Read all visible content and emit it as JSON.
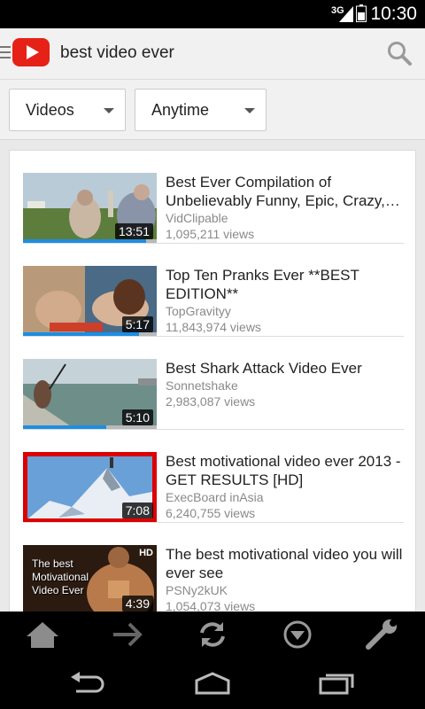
{
  "status": {
    "network": "3G",
    "time": "10:30"
  },
  "search": {
    "query": "best video ever"
  },
  "filters": {
    "type": "Videos",
    "time": "Anytime"
  },
  "results": [
    {
      "title": "Best Ever Compilation of Unbelievably Funny, Epic, Crazy,…",
      "channel": "VidClipable",
      "views": "1,095,211 views",
      "duration": "13:51",
      "progress": 0.92
    },
    {
      "title": "Top Ten Pranks Ever **BEST EDITION**",
      "channel": "TopGravityy",
      "views": "11,843,974 views",
      "duration": "5:17",
      "progress": 0.87
    },
    {
      "title": "Best Shark Attack Video Ever",
      "channel": "Sonnetshake",
      "views": "2,983,087 views",
      "duration": "5:10",
      "progress": 0.62
    },
    {
      "title": "Best motivational video ever 2013 - GET RESULTS [HD]",
      "channel": "ExecBoard inAsia",
      "views": "6,240,755 views",
      "duration": "7:08"
    },
    {
      "title": "The best motivational video you will ever see",
      "channel": "PSNy2kUK",
      "views": "1,054,073 views",
      "duration": "4:39",
      "thumb_caption": [
        "The best",
        "Motivational",
        "Video Ever"
      ],
      "thumb_badge": "HD"
    }
  ],
  "icons": {
    "toolbar": [
      "home-icon",
      "forward-icon",
      "refresh-icon",
      "download-icon",
      "settings-wrench-icon"
    ],
    "navbar": [
      "back-icon",
      "home-icon",
      "recent-apps-icon"
    ]
  },
  "colors": {
    "brand": "#e62117",
    "progress": "#1c8ee3",
    "selected_border": "#dd0000"
  }
}
